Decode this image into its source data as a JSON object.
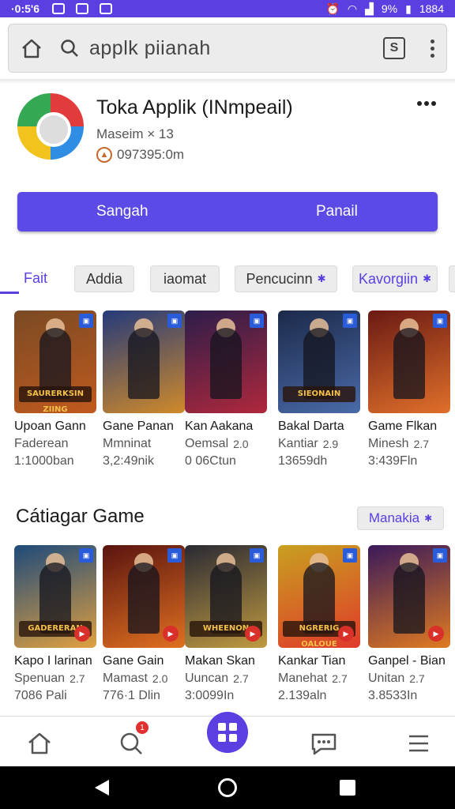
{
  "status_bar": {
    "time": "·0:5'6",
    "battery": "9%",
    "clock": "1884"
  },
  "search": {
    "query": "applk piianah"
  },
  "app": {
    "title": "Toka Applik (INmpeail)",
    "subtitle": "Maseim × 13",
    "meta": "097395:0m"
  },
  "actions": {
    "left_label": "Sangah",
    "right_label": "Panail"
  },
  "chips": [
    "Fait",
    "Addia",
    "iaomat",
    "Pencucinn",
    "Kavorgiin"
  ],
  "row1": [
    {
      "title": "Upoan Gann",
      "sub": "Faderean",
      "num": "",
      "stat": "1:1000ban",
      "banner": "SAURERKSIN ZIING",
      "colors": [
        "#7a4a24",
        "#c05a1e"
      ]
    },
    {
      "title": "Gane Panan",
      "sub": "Mmninat",
      "num": "",
      "stat": "3,2:49nik",
      "banner": "",
      "colors": [
        "#243a7a",
        "#d08a2a"
      ]
    },
    {
      "title": "Kan Aakana",
      "sub": "Oemsal",
      "num": "2.0",
      "stat": "0 06Ctun",
      "banner": "",
      "colors": [
        "#2c1d4a",
        "#b0283c"
      ]
    },
    {
      "title": "Bakal Darta",
      "sub": "Kantiar",
      "num": "2.9",
      "stat": "13659dh",
      "banner": "SIEONAIN",
      "colors": [
        "#1c2a4a",
        "#4a6aa8"
      ]
    },
    {
      "title": "Game Flkan",
      "sub": "Minesh",
      "num": "2.7",
      "stat": "3:439Fln",
      "banner": "",
      "colors": [
        "#6a1a14",
        "#e0702a"
      ]
    }
  ],
  "section": {
    "title": "Cátiagar Game",
    "more_label": "Manakia"
  },
  "row2": [
    {
      "title": "Kapo I larinan",
      "sub": "Spenuan",
      "num": "2.7",
      "stat": "7086 Pali",
      "banner": "GADERERAN",
      "colors": [
        "#1e4a7a",
        "#e0a040"
      ]
    },
    {
      "title": "Gane Gain",
      "sub": "Mamast",
      "num": "2.0",
      "stat": "776·1 Dlin",
      "banner": "",
      "colors": [
        "#5a1410",
        "#e07020"
      ]
    },
    {
      "title": "Makan Skan",
      "sub": "Uuncan",
      "num": "2.7",
      "stat": "3:0099In",
      "banner": "WHEENON",
      "colors": [
        "#2a2a34",
        "#c09a40"
      ]
    },
    {
      "title": "Kankar Tian",
      "sub": "Manehat",
      "num": "2.7",
      "stat": "2.139aln",
      "banner": "NGRERIG OALOUE",
      "colors": [
        "#c8a020",
        "#e03a2a"
      ]
    },
    {
      "title": "Ganpel - Bian",
      "sub": "Unitan",
      "num": "2.7",
      "stat": "3.8533In",
      "banner": "",
      "colors": [
        "#3a1a5a",
        "#e07a20"
      ]
    }
  ],
  "bottom_nav": {
    "notif_count": "1"
  }
}
